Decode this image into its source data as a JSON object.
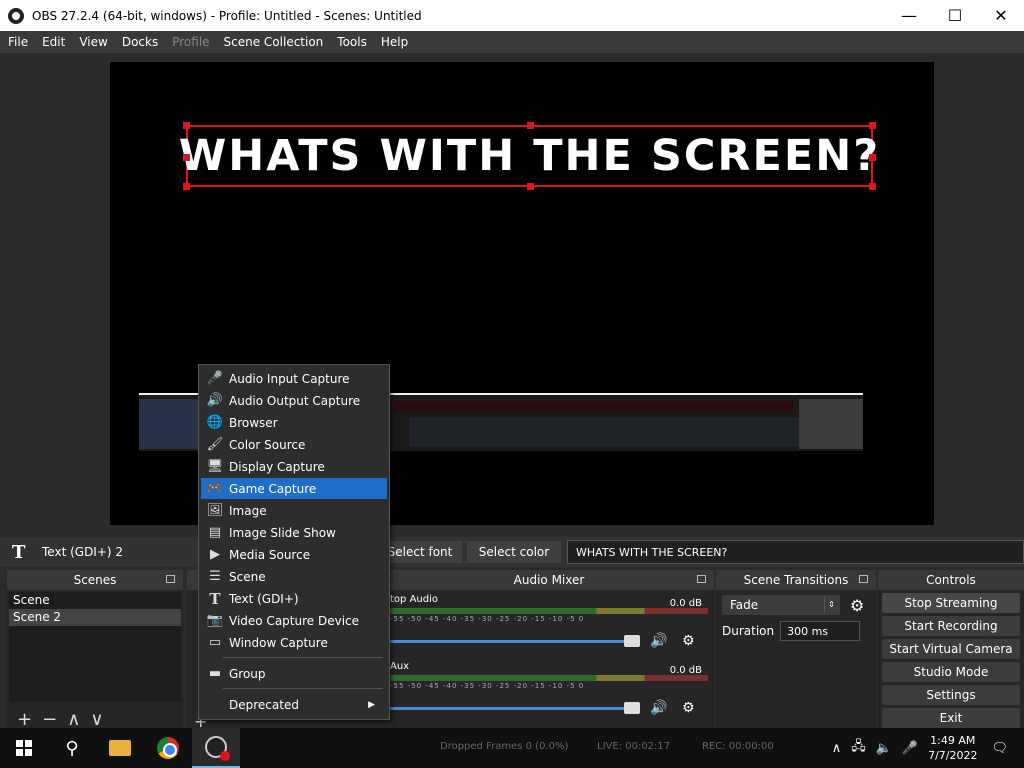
{
  "window": {
    "title": "OBS 27.2.4 (64-bit, windows) - Profile: Untitled - Scenes: Untitled",
    "minimize": "—",
    "maximize": "☐",
    "close": "✕"
  },
  "menu": {
    "items": [
      {
        "label": "File",
        "disabled": false
      },
      {
        "label": "Edit",
        "disabled": false
      },
      {
        "label": "View",
        "disabled": false
      },
      {
        "label": "Docks",
        "disabled": false
      },
      {
        "label": "Profile",
        "disabled": true
      },
      {
        "label": "Scene Collection",
        "disabled": false
      },
      {
        "label": "Tools",
        "disabled": false
      },
      {
        "label": "Help",
        "disabled": false
      }
    ]
  },
  "preview": {
    "text_source": "WHATS WITH THE SCREEN?",
    "selection_color": "#e0141e"
  },
  "properties": {
    "source_icon": "T",
    "source_name": "Text (GDI+) 2",
    "select_font": "Select font",
    "select_color": "Select color",
    "text_value": "WHATS WITH THE SCREEN?"
  },
  "scenes": {
    "title": "Scenes",
    "items": [
      "Scene",
      "Scene 2"
    ]
  },
  "mixer": {
    "title": "Audio Mixer",
    "tracks": [
      {
        "name": "top Audio",
        "db": "0.0 dB"
      },
      {
        "name": "Aux",
        "db": "0.0 dB"
      }
    ],
    "scale": "-55 -50 -45 -40 -35 -30 -25 -20 -15 -10 -5 0"
  },
  "transitions": {
    "title": "Scene Transitions",
    "selected": "Fade",
    "duration_label": "Duration",
    "duration_value": "300 ms"
  },
  "controls": {
    "title": "Controls",
    "buttons": [
      "Stop Streaming",
      "Start Recording",
      "Start Virtual Camera",
      "Studio Mode",
      "Settings",
      "Exit"
    ]
  },
  "context_menu": {
    "items": [
      {
        "icon": "🎤",
        "label": "Audio Input Capture"
      },
      {
        "icon": "🔊",
        "label": "Audio Output Capture"
      },
      {
        "icon": "🌐",
        "label": "Browser"
      },
      {
        "icon": "🖌",
        "label": "Color Source"
      },
      {
        "icon": "🖥",
        "label": "Display Capture"
      },
      {
        "icon": "🎮",
        "label": "Game Capture"
      },
      {
        "icon": "🖼",
        "label": "Image"
      },
      {
        "icon": "▤",
        "label": "Image Slide Show"
      },
      {
        "icon": "▶",
        "label": "Media Source"
      },
      {
        "icon": "☰",
        "label": "Scene"
      },
      {
        "icon": "T",
        "label": "Text (GDI+)"
      },
      {
        "icon": "📷",
        "label": "Video Capture Device"
      },
      {
        "icon": "▭",
        "label": "Window Capture"
      },
      {
        "icon": "▬",
        "label": "Group"
      },
      {
        "icon": "",
        "label": "Deprecated"
      }
    ],
    "highlighted": "Game Capture",
    "submenu_arrow": "▶"
  },
  "status": {
    "dropped": "Dropped Frames 0 (0.0%)",
    "live": "LIVE: 00:02:17",
    "rec": "REC: 00:00:00"
  },
  "taskbar": {
    "time": "1:49 AM",
    "date": "7/7/2022"
  }
}
